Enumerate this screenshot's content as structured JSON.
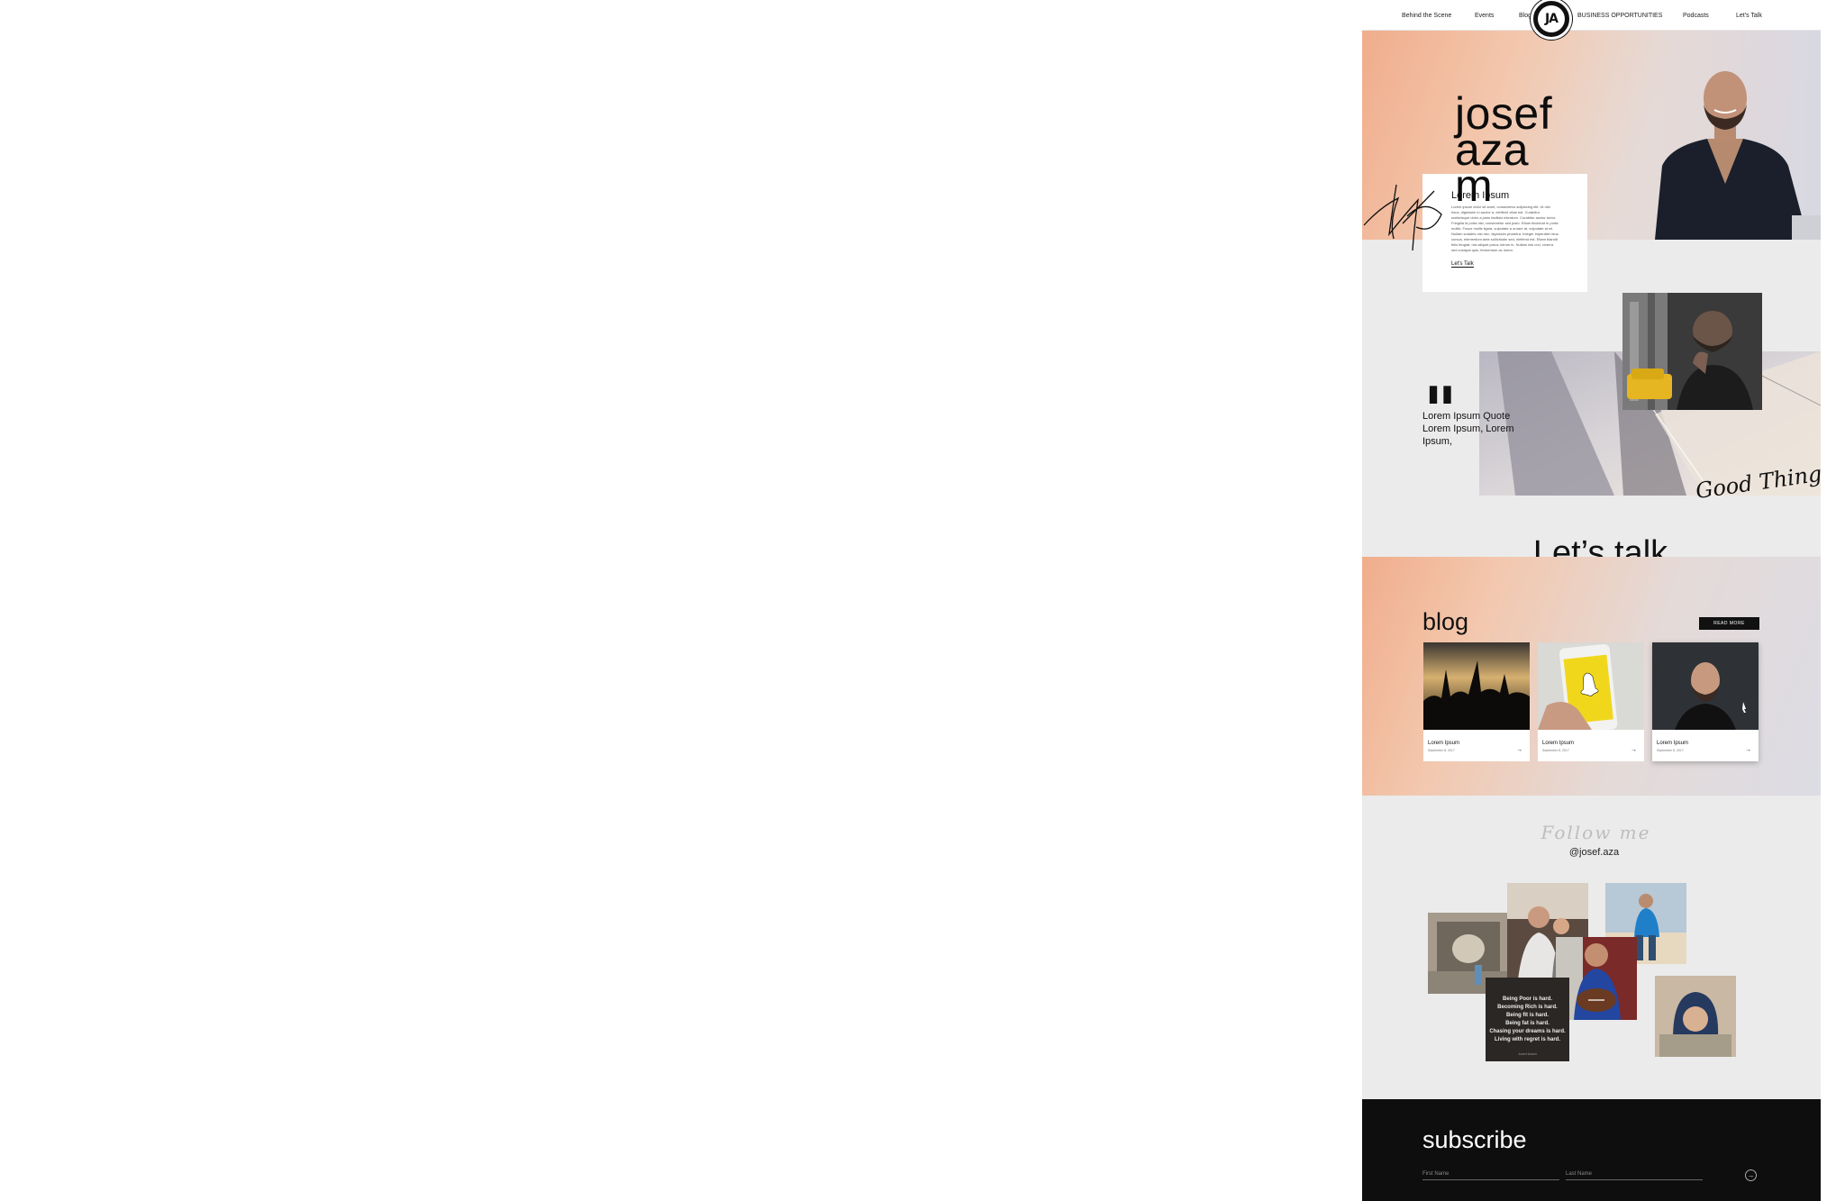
{
  "nav": {
    "items": [
      "Behind the Scene",
      "Events",
      "Blog",
      "BUSINESS OPPORTUNITIES",
      "Podcasts",
      "Let's Talk"
    ],
    "logo_text": "JA"
  },
  "hero": {
    "name_lines": [
      "josef",
      "aza",
      "m"
    ],
    "card_title": "Lorem Ipsum",
    "card_body": "Lorem ipsum dolor sit amet, consectetur adipiscing elit. Ut nisi risus, dignissim in auctor a, eleifend vitae est. Curabitur scelerisque dolor a justo facilisis interdum. Curabitur auctor tortor. Fringilla id porta nisl, consectetur sed justo. Etiam tincidunt in porta mollis. Fusce mollis ligula, vulputate a ornare at, vulputate at mi. Nullam sodales nisi nec, dignissim pharetra. Integer imperdiet risus cursus, elementum ante sollicitudin sed, eleifend est. Etiam blandit felis feugiat, nisi aliquet purus rutrum in. Nullam nisi orci, viverra sed volutpat quis, fermentum ac lorem.",
    "card_link": "Let's Talk"
  },
  "quote": {
    "mark": "\"",
    "text": "Lorem Ipsum Quote Lorem Ipsum, Lorem Ipsum,",
    "script_caption": "Good Things"
  },
  "lets_talk": "Let’s talk",
  "blog": {
    "title": "blog",
    "read_more": "READ MORE",
    "cards": [
      {
        "title": "Lorem Ipsum",
        "date": "September 8, 2017",
        "arrow": "→"
      },
      {
        "title": "Lorem Ipsum",
        "date": "September 8, 2017",
        "arrow": "→"
      },
      {
        "title": "Lorem Ipsum",
        "date": "September 8, 2017",
        "arrow": "→"
      }
    ]
  },
  "follow": {
    "script": "Follow me",
    "handle": "@josef.aza",
    "quote_post": [
      "Being Poor is hard.",
      "Becoming Rich is hard.",
      "Being fit is hard.",
      "Being fat is hard.",
      "Chasing your dreams is hard.",
      "Living with regret is hard.",
      "Josef Azam"
    ]
  },
  "subscribe": {
    "title": "subscribe",
    "first_name_placeholder": "First Name",
    "last_name_placeholder": "Last Name",
    "submit_icon": "arrow-right-circle-icon"
  }
}
